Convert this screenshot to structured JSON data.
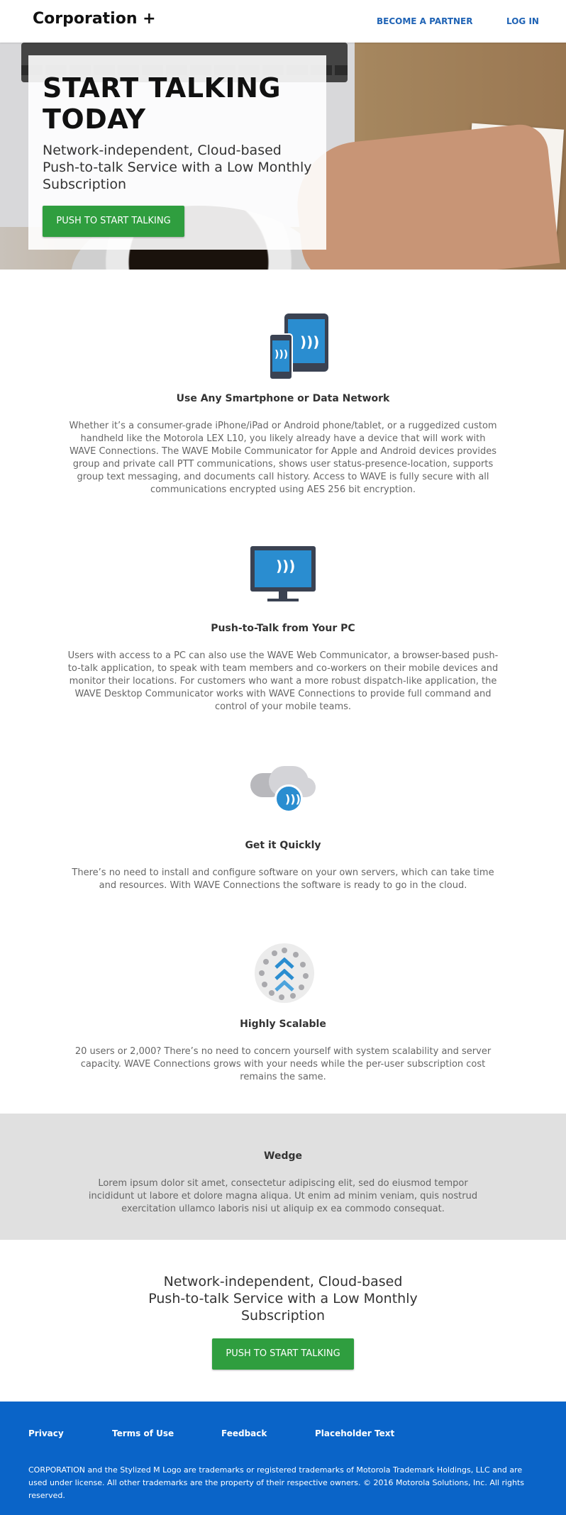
{
  "header": {
    "logo": "Corporation +",
    "nav": {
      "partner": "BECOME A PARTNER",
      "login": "LOG IN"
    }
  },
  "hero": {
    "title": "START TALKING TODAY",
    "subtitle": "Network-independent, Cloud-based Push-to-talk Service with a Low Monthly Subscription",
    "button": "PUSH TO START TALKING"
  },
  "features": [
    {
      "icon": "smartphone-tablet-icon",
      "title": "Use Any Smartphone or Data Network",
      "desc": "Whether it’s a consumer-grade iPhone/iPad or Android phone/tablet, or a ruggedized custom handheld like the Motorola LEX L10, you likely already have a device that will work with WAVE Connections. The WAVE Mobile Communicator for Apple and Android devices provides group and private call PTT communications, shows user status-presence-location, supports group text messaging, and documents call history. Access to WAVE is fully secure with all communications encrypted using AES 256 bit encryption."
    },
    {
      "icon": "monitor-icon",
      "title": "Push-to-Talk from Your PC",
      "desc": "Users with access to a PC can also use the WAVE Web Communicator, a browser-based push-to-talk application, to speak with team members and co-workers on their mobile devices and monitor their locations. For customers who want a more robust dispatch-like application, the WAVE Desktop Communicator works with WAVE Connections to provide full command and control of your mobile teams."
    },
    {
      "icon": "cloud-icon",
      "title": "Get it Quickly",
      "desc": "There’s no need to install and configure software on your own servers, which can take time and resources. With WAVE Connections the software is ready to go in the cloud."
    },
    {
      "icon": "scalable-icon",
      "title": "Highly Scalable",
      "desc": "20 users or 2,000? There’s no need to concern yourself with system scalability and server capacity. WAVE Connections grows with your needs while the per-user subscription cost remains the same."
    }
  ],
  "wedge": {
    "title": "Wedge",
    "text": "Lorem ipsum dolor sit amet, consectetur adipiscing elit, sed do eiusmod tempor incididunt ut labore et dolore magna aliqua. Ut enim ad minim veniam, quis nostrud exercitation ullamco laboris nisi ut aliquip ex ea commodo consequat."
  },
  "cta": {
    "text": "Network-independent, Cloud-based Push-to-talk Service with a Low Monthly Subscription",
    "button": "PUSH TO START TALKING"
  },
  "footer": {
    "links": [
      "Privacy",
      "Terms of Use",
      "Feedback",
      "Placeholder Text"
    ],
    "legal": "CORPORATION and the Stylized M Logo are trademarks or registered trademarks of Motorola Trademark Holdings, LLC and are used under license. All other trademarks are the property of their respective owners. © 2016 Motorola Solutions, Inc. All rights reserved."
  },
  "colors": {
    "brand_blue": "#0a64c8",
    "nav_blue": "#1f63b5",
    "button_green": "#2f9e3f",
    "icon_blue": "#2a8dd0"
  }
}
